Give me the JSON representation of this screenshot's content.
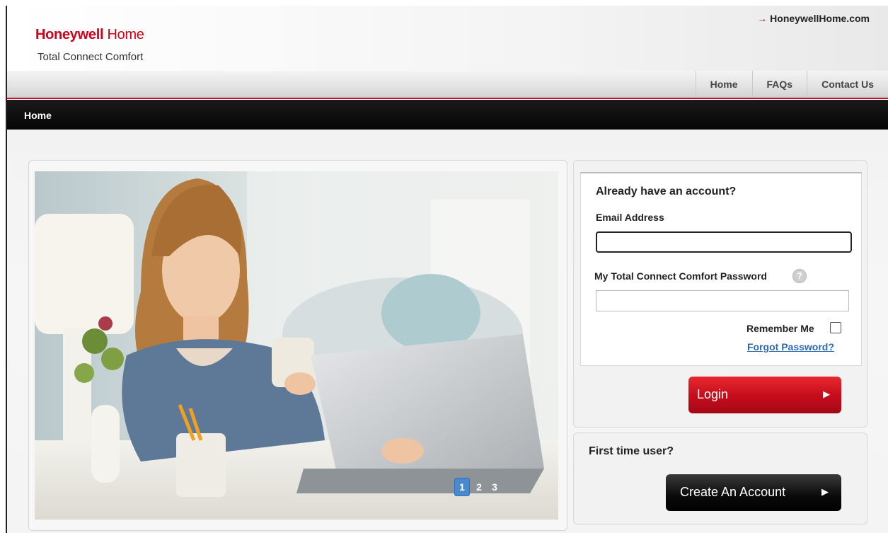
{
  "header": {
    "brand_bold": "Honeywell",
    "brand_light": " Home",
    "subtitle": "Total Connect Comfort",
    "external_link": "HoneywellHome.com"
  },
  "nav": {
    "items": [
      {
        "label": "Home"
      },
      {
        "label": "FAQs"
      },
      {
        "label": "Contact Us"
      }
    ]
  },
  "breadcrumb": {
    "current": "Home"
  },
  "carousel": {
    "pages": [
      "1",
      "2",
      "3"
    ],
    "active_page": "1"
  },
  "login": {
    "title": "Already have an account?",
    "email_label": "Email Address",
    "email_value": "",
    "password_label": "My Total Connect Comfort Password",
    "password_value": "",
    "remember_label": "Remember Me",
    "forgot_label": "Forgot Password?",
    "login_button": "Login"
  },
  "signup": {
    "title": "First time user?",
    "create_button": "Create An Account"
  },
  "colors": {
    "brand_red": "#d0021b",
    "link_blue": "#2a6ab2",
    "pager_active": "#4a88d0"
  }
}
